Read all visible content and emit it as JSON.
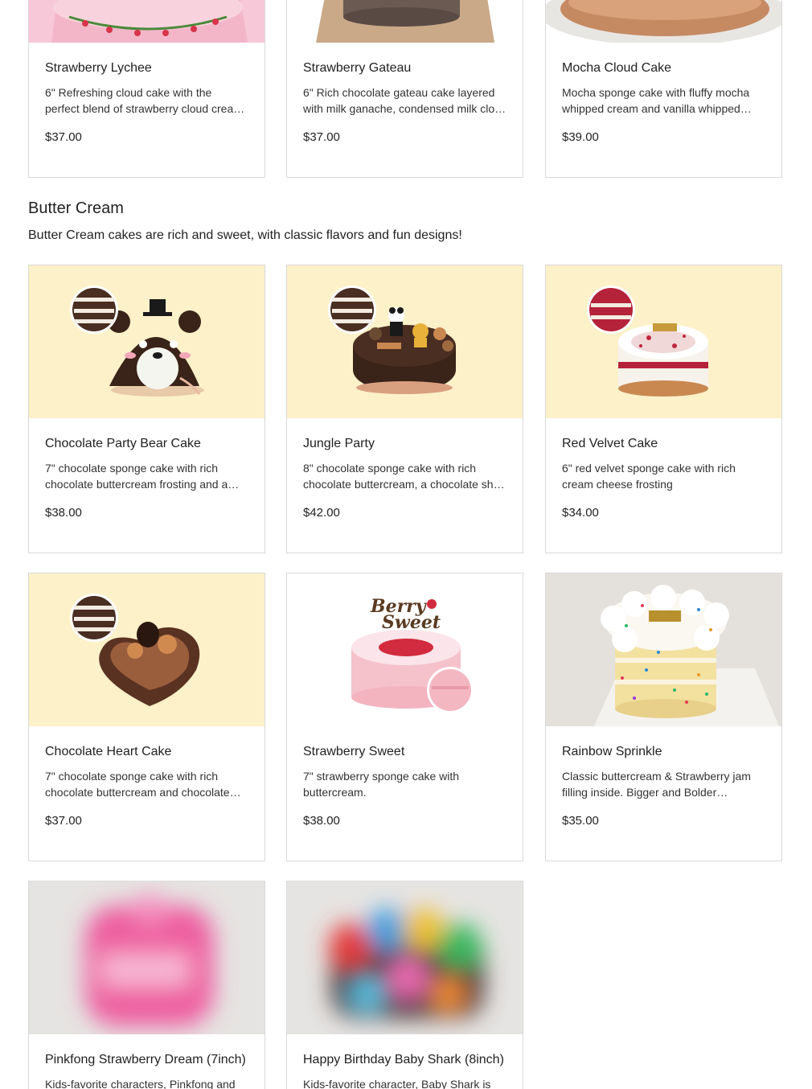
{
  "colors": {
    "card_border": "#d9d9d9",
    "butter_bg": "#fdf1c9",
    "text": "#222222"
  },
  "top_row": [
    {
      "title": "Strawberry Lychee",
      "description": "6\" Refreshing cloud cake with the perfect blend of strawberry cloud cream and…",
      "price": "$37.00",
      "image": "strawberry-lychee-cake-image"
    },
    {
      "title": "Strawberry Gateau",
      "description": "6\" Rich chocolate gateau cake layered with milk ganache, condensed milk clo…",
      "price": "$37.00",
      "image": "strawberry-gateau-cake-image"
    },
    {
      "title": "Mocha Cloud Cake",
      "description": "Mocha sponge cake with fluffy mocha whipped cream and vanilla whipped…",
      "price": "$39.00",
      "image": "mocha-cloud-cake-image"
    }
  ],
  "section": {
    "title": "Butter Cream",
    "description": "Butter Cream cakes are rich and sweet, with classic flavors and fun designs!"
  },
  "products": [
    {
      "title": "Chocolate Party Bear Cake",
      "description": "7\" chocolate sponge cake with rich chocolate buttercream frosting and a…",
      "price": "$38.00",
      "image": "bear-cake-image"
    },
    {
      "title": "Jungle Party",
      "description": "8\" chocolate sponge cake with rich chocolate buttercream, a chocolate sh…",
      "price": "$42.00",
      "image": "jungle-party-cake-image"
    },
    {
      "title": "Red Velvet Cake",
      "description": "6\" red velvet sponge cake with rich cream cheese frosting",
      "price": "$34.00",
      "image": "red-velvet-cake-image"
    },
    {
      "title": "Chocolate Heart Cake",
      "description": "7\" chocolate sponge cake with rich chocolate buttercream and chocolate…",
      "price": "$37.00",
      "image": "chocolate-heart-cake-image"
    },
    {
      "title": "Strawberry Sweet",
      "description": "7\" strawberry sponge cake with buttercream.",
      "price": "$38.00",
      "image": "strawberry-sweet-cake-image",
      "topper_text_1": "Berry",
      "topper_text_2": "Sweet"
    },
    {
      "title": "Rainbow Sprinkle",
      "description": "Classic buttercream & Strawberry jam filling inside. Bigger and Bolder sprinkles.",
      "price": "$35.00",
      "image": "rainbow-sprinkle-cake-image"
    },
    {
      "title": "Pinkfong Strawberry Dream (7inch)",
      "description": "Kids-favorite characters, Pinkfong and",
      "price": "",
      "image": "pinkfong-cake-image-blurred"
    },
    {
      "title": "Happy Birthday Baby Shark (8inch)",
      "description": "Kids-favorite character, Baby Shark is",
      "price": "",
      "image": "baby-shark-cake-image-blurred"
    }
  ]
}
